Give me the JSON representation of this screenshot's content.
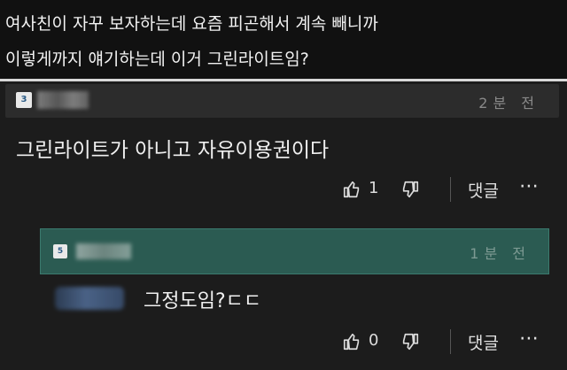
{
  "post": {
    "title_line1": "여사친이 자꾸 보자하는데 요즘 피곤해서 계속 빼니까",
    "title_line2": "이렇게까지 얘기하는데 이거 그린라이트임?"
  },
  "comment": {
    "level": "3",
    "time": "2분 전",
    "body": "그린라이트가 아니고 자유이용권이다",
    "like_count": "1",
    "reply_label": "댓글",
    "more": "⋯"
  },
  "reply": {
    "level": "5",
    "time": "1분 전",
    "body": "그정도임?ㄷㄷ",
    "like_count": "0",
    "reply_label": "댓글",
    "more": "⋯"
  },
  "icons": [
    "thumbs-up-icon",
    "thumbs-down-icon",
    "more-icon"
  ],
  "colors": {
    "reply_highlight": "#2b5b52",
    "background": "#1c1c1c"
  }
}
